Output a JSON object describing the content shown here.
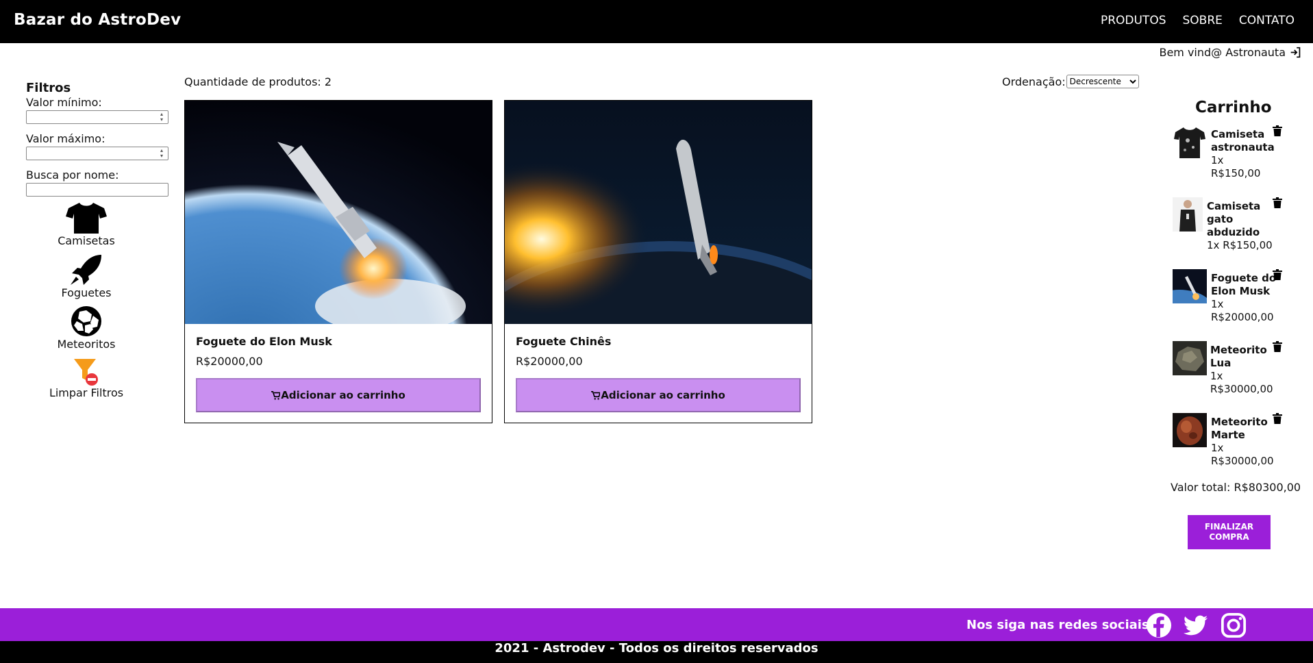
{
  "header": {
    "brand": "Bazar do AstroDev",
    "nav": [
      "PRODUTOS",
      "SOBRE",
      "CONTATO"
    ]
  },
  "welcome": "Bem vind@ Astronauta",
  "filters": {
    "title": "Filtros",
    "min_label": "Valor mínimo:",
    "max_label": "Valor máximo:",
    "name_label": "Busca por nome:",
    "categories": [
      {
        "label": "Camisetas",
        "icon": "tshirt-icon"
      },
      {
        "label": "Foguetes",
        "icon": "rocket-icon"
      },
      {
        "label": "Meteoritos",
        "icon": "meteorite-icon"
      },
      {
        "label": "Limpar Filtros",
        "icon": "clear-filter-icon"
      }
    ]
  },
  "main": {
    "quantity": "Quantidade de produtos: 2",
    "order_label": "Ordenação:",
    "order_selected": "Decrescente",
    "products": [
      {
        "name": "Foguete do Elon Musk",
        "price": "R$20000,00",
        "button": "Adicionar ao carrinho"
      },
      {
        "name": "Foguete Chinês",
        "price": "R$20000,00",
        "button": "Adicionar ao carrinho"
      }
    ]
  },
  "cart": {
    "title": "Carrinho",
    "items": [
      {
        "name": "Camiseta astronauta",
        "qty": "1x",
        "price": "R$150,00"
      },
      {
        "name": "Camiseta gato abduzido",
        "qty": "1x",
        "price": "R$150,00"
      },
      {
        "name": "Foguete do Elon Musk",
        "qty": "1x",
        "price": "R$20000,00"
      },
      {
        "name": "Meteorito Lua",
        "qty": "1x",
        "price": "R$30000,00"
      },
      {
        "name": "Meteorito Marte",
        "qty": "1x",
        "price": "R$30000,00"
      }
    ],
    "total": "Valor total: R$80300,00",
    "checkout": "FINALIZAR COMPRA"
  },
  "footer": {
    "follow": "Nos siga nas redes sociais",
    "social": [
      "facebook-icon",
      "twitter-icon",
      "instagram-icon"
    ],
    "copyright": "2021 - Astrodev - Todos os direitos reservados"
  },
  "colors": {
    "header_bg": "#000000",
    "accent_purple": "#9b1fd9",
    "button_lilac": "#c98ff0"
  }
}
